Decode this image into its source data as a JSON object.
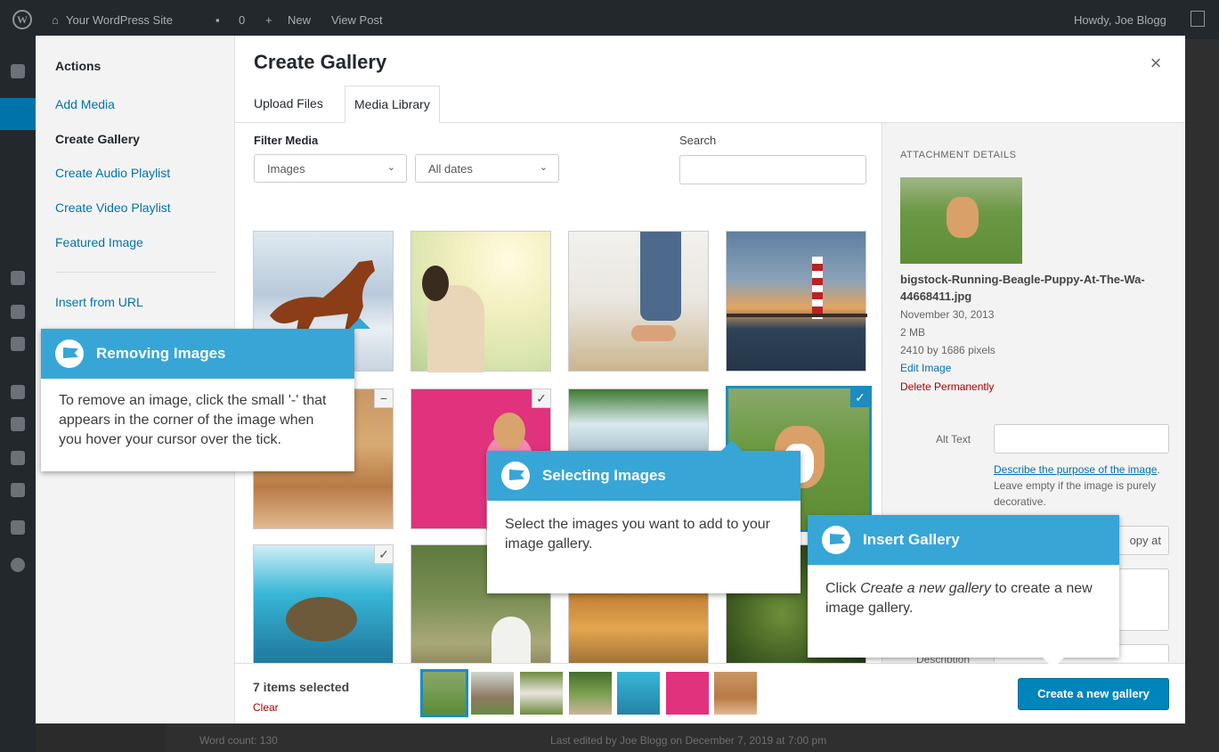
{
  "admin_bar": {
    "site_name": "Your WordPress Site",
    "comments": "0",
    "new": "New",
    "view_post": "View Post",
    "howdy": "Howdy, Joe Blogg"
  },
  "underlying_footer": {
    "word_count": "Word count: 130",
    "last_edited": "Last edited by Joe Blogg on December 7, 2019 at 7:00 pm"
  },
  "modal": {
    "title": "Create Gallery",
    "close_icon": "×",
    "menu": {
      "heading": "Actions",
      "items": [
        {
          "label": "Add Media",
          "current": false
        },
        {
          "label": "Create Gallery",
          "current": true
        },
        {
          "label": "Create Audio Playlist",
          "current": false
        },
        {
          "label": "Create Video Playlist",
          "current": false
        },
        {
          "label": "Featured Image",
          "current": false
        }
      ],
      "insert_from_url": "Insert from URL"
    },
    "tabs": [
      {
        "label": "Upload Files",
        "active": false
      },
      {
        "label": "Media Library",
        "active": true
      }
    ],
    "filter": {
      "label": "Filter Media",
      "type_value": "Images",
      "date_value": "All dates",
      "search_label": "Search",
      "search_value": ""
    },
    "attachment_details": {
      "heading": "ATTACHMENT DETAILS",
      "filename": "bigstock-Running-Beagle-Puppy-At-The-Wa-44668411.jpg",
      "date": "November 30, 2013",
      "size": "2 MB",
      "dimensions": "2410 by 1686 pixels",
      "edit_image": "Edit Image",
      "delete": "Delete Permanently",
      "alt_text_label": "Alt Text",
      "alt_help_link": "Describe the purpose of the image",
      "alt_help_rest": ". Leave empty if the image is purely decorative.",
      "copy_button": "opy at",
      "description_label": "Description"
    },
    "toolbar": {
      "selection_count": "7 items selected",
      "clear": "Clear",
      "create_button": "Create a new gallery"
    }
  },
  "callouts": {
    "removing": {
      "title": "Removing Images",
      "body": "To remove an image, click the small '-' that appears in the corner of the image when you hover your cursor over the tick."
    },
    "selecting": {
      "title": "Selecting Images",
      "body": "Select the images you want to add to your image gallery."
    },
    "insert": {
      "title": "Insert Gallery",
      "body_pre": "Click ",
      "body_em": "Create a new gallery",
      "body_post": " to create a new image gallery."
    }
  },
  "icons": {
    "check": "✓",
    "minus": "−",
    "chevron": "⌄"
  },
  "colors": {
    "accent": "#0085ba",
    "callout_header": "#37a6d6",
    "link": "#0073aa",
    "danger": "#a00"
  }
}
